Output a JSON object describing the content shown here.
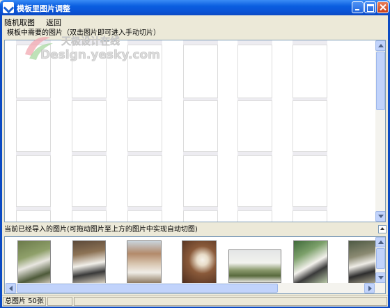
{
  "window": {
    "title": "模板里图片调整"
  },
  "menu": {
    "items": [
      {
        "label": "随机取图"
      },
      {
        "label": "返回"
      }
    ]
  },
  "template_panel": {
    "label": "模板中需要的图片（双击图片即可进入手动切片）"
  },
  "import_panel": {
    "label": "当前已经导入的图片(可拖动图片至上方的图片中实现自动切图)"
  },
  "watermark": {
    "brand": "天极设计在线",
    "site": "Design.yesky.com"
  },
  "status": {
    "count_text": "总图片 50张",
    "cell2": "",
    "cell3": ""
  },
  "colors": {
    "title_bar": "#0a5ee0",
    "frame": "#0b4ac3",
    "panel_border": "#7f9db9",
    "scrollbar": "#c1d3fb"
  },
  "icons": [
    "app-icon",
    "minimize-icon",
    "maximize-icon",
    "close-icon",
    "scroll-up-icon",
    "scroll-down-icon",
    "scroll-left-icon",
    "scroll-right-icon",
    "collapse-icon"
  ]
}
